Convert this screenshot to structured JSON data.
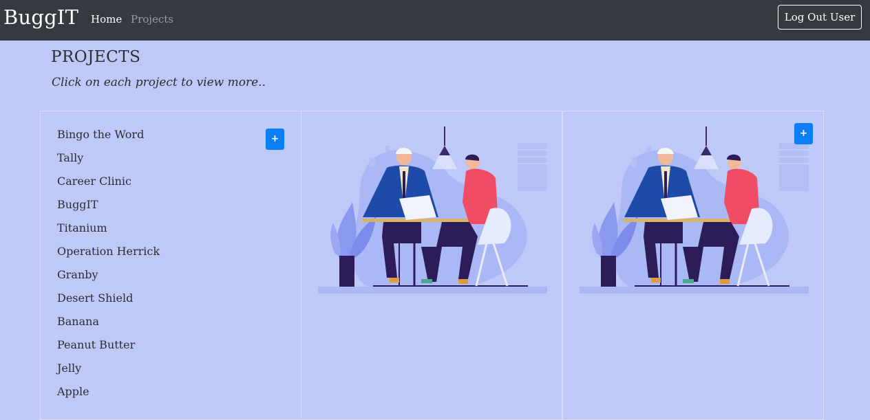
{
  "navbar": {
    "brand": "BuggIT",
    "links": [
      "Home",
      "Projects"
    ],
    "logout_label": "Log Out User"
  },
  "header": {
    "title": "PROJECTS",
    "subtitle": "Click on each project to view more.."
  },
  "projects": [
    "Bingo the Word",
    "Tally",
    "Career Clinic",
    "BuggIT",
    "Titanium",
    "Operation Herrick",
    "Granby",
    "Desert Shield",
    "Banana",
    "Peanut Butter",
    "Jelly",
    "Apple"
  ],
  "buttons": {
    "add_symbol": "+"
  },
  "colors": {
    "background": "#bec9f8",
    "navbar": "#343a40",
    "button_primary": "#0d7ef8",
    "text": "#2a2e33",
    "nav_inactive": "#9a9ea3"
  }
}
